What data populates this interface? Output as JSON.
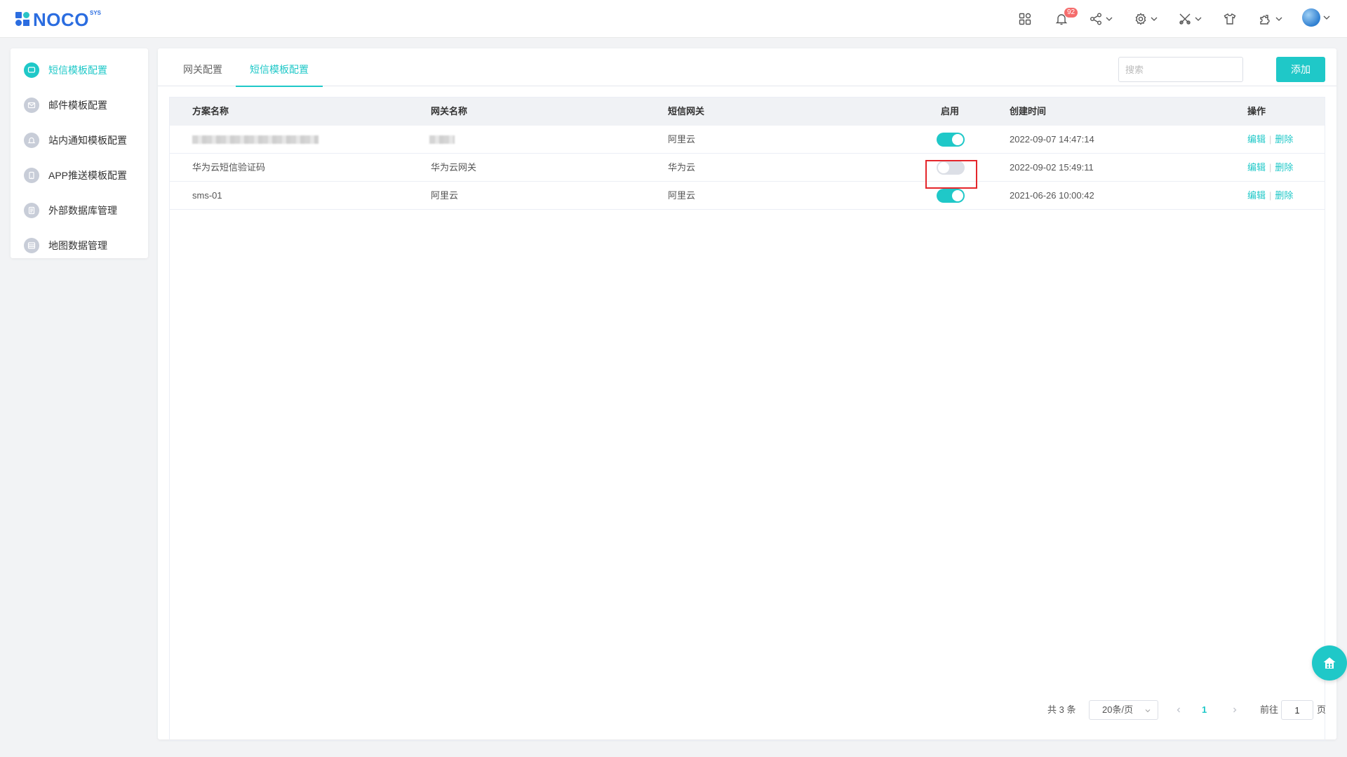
{
  "brand": {
    "name": "NOCO",
    "sup": "SYS"
  },
  "topbar": {
    "notification_count": "92"
  },
  "sidebar": {
    "items": [
      {
        "label": "短信模板配置",
        "icon": "message-icon",
        "active": true
      },
      {
        "label": "邮件模板配置",
        "icon": "mail-icon",
        "active": false
      },
      {
        "label": "站内通知模板配置",
        "icon": "bell-icon",
        "active": false
      },
      {
        "label": "APP推送模板配置",
        "icon": "mobile-icon",
        "active": false
      },
      {
        "label": "外部数据库管理",
        "icon": "database-icon",
        "active": false
      },
      {
        "label": "地图数据管理",
        "icon": "map-icon",
        "active": false
      }
    ]
  },
  "tabs": [
    {
      "label": "网关配置",
      "active": false
    },
    {
      "label": "短信模板配置",
      "active": true
    }
  ],
  "search": {
    "placeholder": "搜索",
    "value": ""
  },
  "add_label": "添加",
  "table": {
    "headers": {
      "name": "方案名称",
      "gateway_name": "网关名称",
      "gateway": "短信网关",
      "enabled": "启用",
      "created": "创建时间",
      "ops": "操作"
    },
    "rows": [
      {
        "name": "",
        "gateway_name": "",
        "gateway": "阿里云",
        "enabled": true,
        "created": "2022-09-07 14:47:14",
        "redacted": true
      },
      {
        "name": "华为云短信验证码",
        "gateway_name": "华为云网关",
        "gateway": "华为云",
        "enabled": false,
        "created": "2022-09-02 15:49:11",
        "redacted": false
      },
      {
        "name": "sms-01",
        "gateway_name": "阿里云",
        "gateway": "阿里云",
        "enabled": true,
        "created": "2021-06-26 10:00:42",
        "redacted": false
      }
    ],
    "edit_label": "编辑",
    "delete_label": "删除"
  },
  "pagination": {
    "total": "共 3 条",
    "page_size": "20条/页",
    "current_page": "1",
    "goto_label": "前往",
    "goto_value": "1",
    "page_suffix": "页"
  },
  "colors": {
    "accent": "#1fc8c8",
    "brand": "#2b6de0",
    "badge": "#f56c6c",
    "highlight": "#e4262b"
  }
}
